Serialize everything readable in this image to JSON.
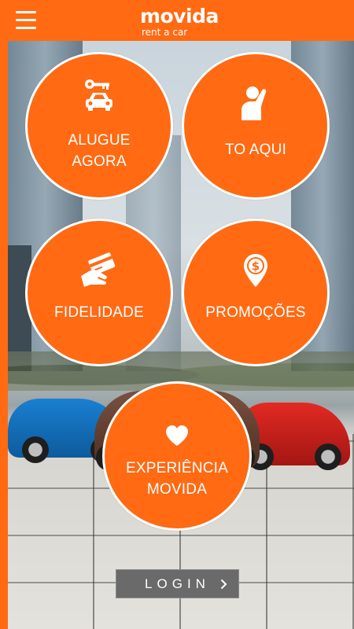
{
  "header": {
    "menu_icon": "hamburger-menu-icon",
    "logo": {
      "word": "movida",
      "tagline": "rent a car"
    }
  },
  "colors": {
    "brand_orange": "#ff6a13",
    "white": "#ffffff",
    "login_bg": "#6a6a6a"
  },
  "tiles": [
    {
      "id": "alugue",
      "icon": "car-key-icon",
      "line1": "ALUGUE",
      "line2": "AGORA"
    },
    {
      "id": "toaqui",
      "icon": "raised-hand-icon",
      "line1": "TO AQUI",
      "line2": ""
    },
    {
      "id": "fidelidade",
      "icon": "hand-card-icon",
      "line1": "FIDELIDADE",
      "line2": ""
    },
    {
      "id": "promocoes",
      "icon": "dollar-pin-icon",
      "line1": "PROMOÇÕES",
      "line2": ""
    },
    {
      "id": "experiencia",
      "icon": "heart-icon",
      "line1": "EXPERIÊNCIA",
      "line2": "MOVIDA"
    }
  ],
  "login": {
    "label": "LOGIN",
    "icon": "chevron-right-icon"
  }
}
